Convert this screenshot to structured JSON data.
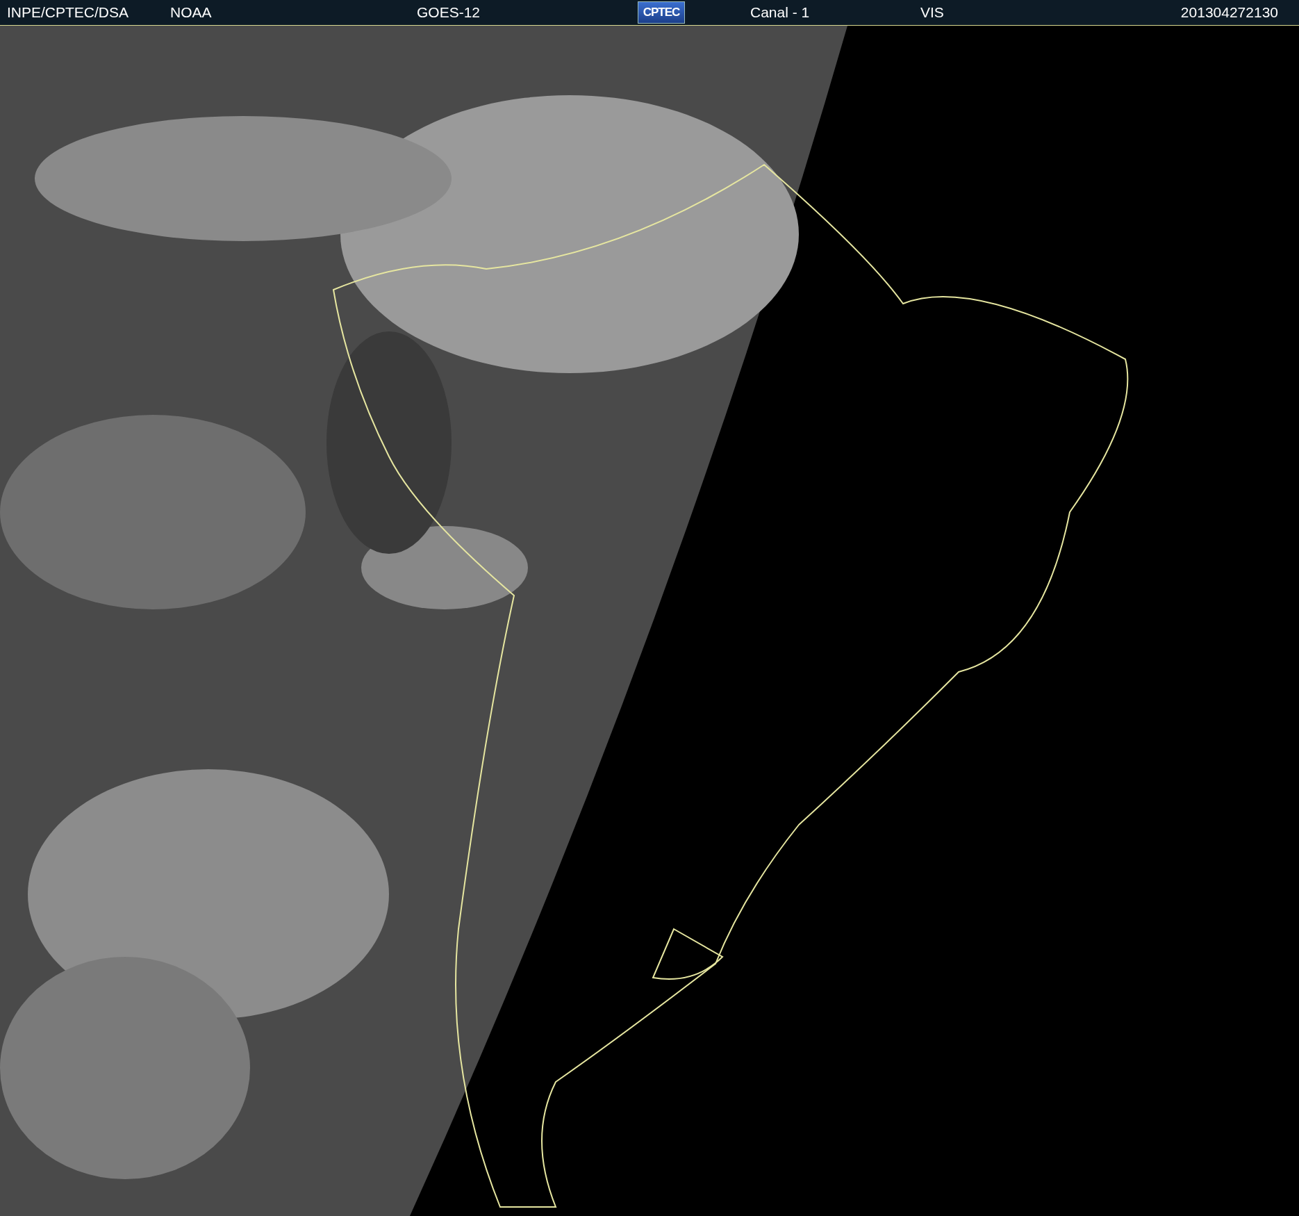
{
  "header": {
    "source": "INPE/CPTEC/DSA",
    "agency": "NOAA",
    "satellite": "GOES-12",
    "logo": "CPTEC",
    "channel": "Canal - 1",
    "band": "VIS",
    "timestamp": "201304272130"
  }
}
